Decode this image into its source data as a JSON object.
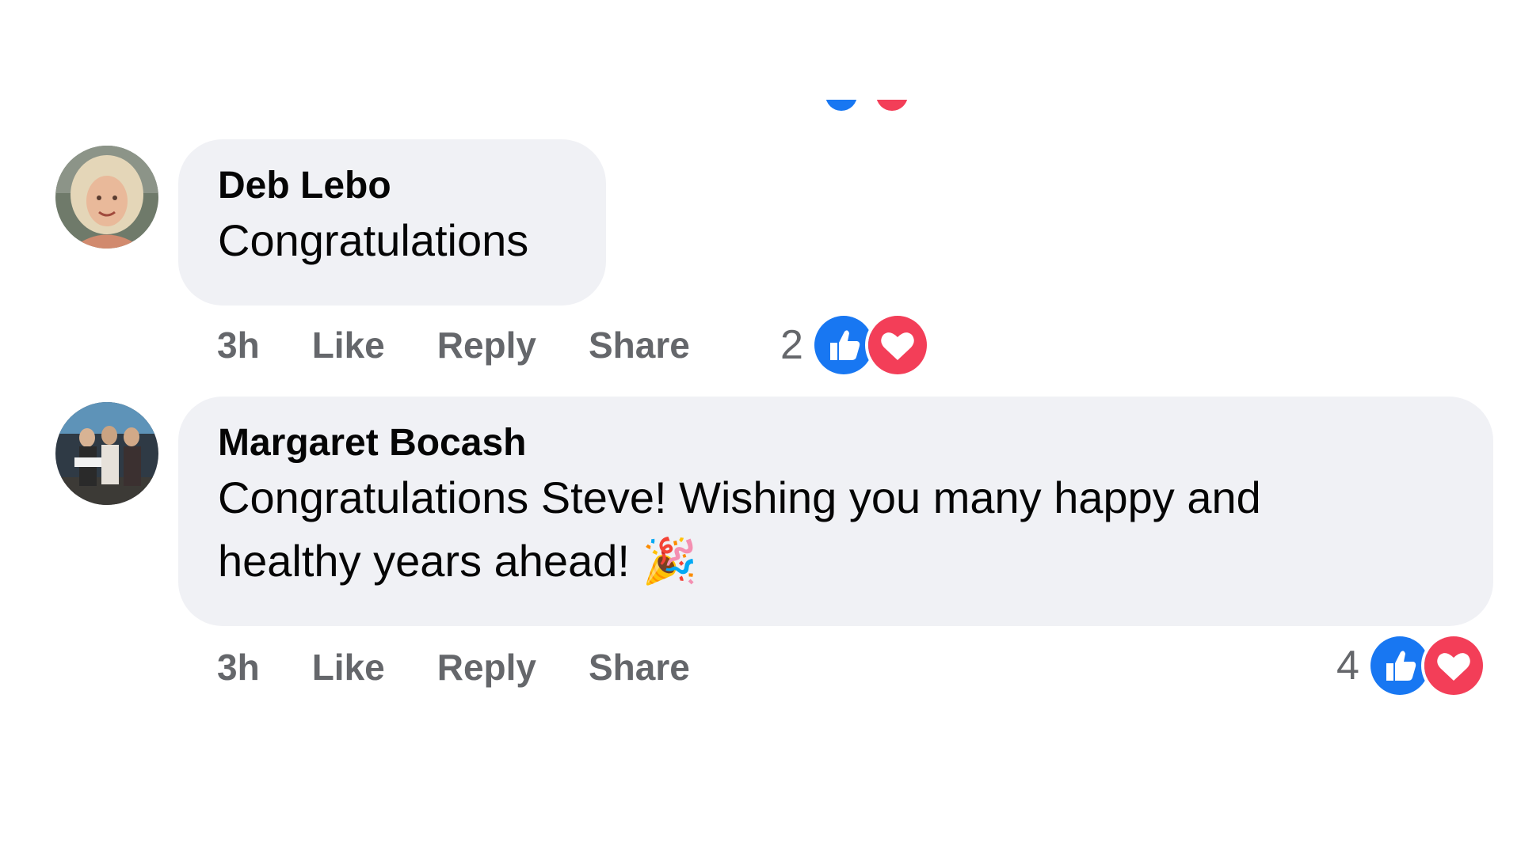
{
  "comments": [
    {
      "author": "Deb Lebo",
      "text": "Congratulations",
      "time": "3h",
      "actions": {
        "like": "Like",
        "reply": "Reply",
        "share": "Share"
      },
      "reaction_count": "2"
    },
    {
      "author": "Margaret Bocash",
      "text": "Congratulations Steve! Wishing you many happy and\nhealthy years ahead! 🎉",
      "time": "3h",
      "actions": {
        "like": "Like",
        "reply": "Reply",
        "share": "Share"
      },
      "reaction_count": "4"
    }
  ],
  "reaction_icons": [
    "like-icon",
    "love-icon"
  ],
  "colors": {
    "like_blue": "#1877f2",
    "love_red": "#f33e58",
    "bubble_bg": "#f0f1f5",
    "secondary_text": "#65676b"
  }
}
